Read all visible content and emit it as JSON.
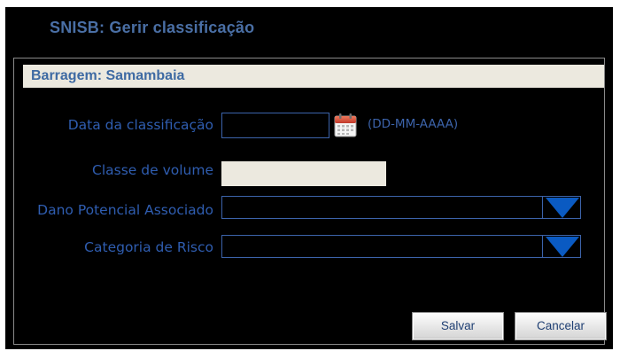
{
  "window": {
    "title": "SNISB: Gerir classificação"
  },
  "panel": {
    "header": "Barragem: Samambaia"
  },
  "form": {
    "data_classificacao": {
      "label": "Data da classificação",
      "value": "",
      "format_hint": "(DD-MM-AAAA)",
      "calendar_icon": "calendar-icon"
    },
    "classe_volume": {
      "label": "Classe de volume",
      "value": ""
    },
    "dano_potencial": {
      "label": "Dano Potencial Associado",
      "selected": ""
    },
    "categoria_risco": {
      "label": "Categoria de Risco",
      "selected": ""
    }
  },
  "buttons": {
    "save": "Salvar",
    "cancel": "Cancelar"
  },
  "colors": {
    "background": "#000000",
    "title": "#4a6fa5",
    "label": "#2f5db0",
    "field_border": "#3c63aa",
    "header_bar": "#ece9df",
    "dropdown_arrow": "#0a5ac2"
  }
}
